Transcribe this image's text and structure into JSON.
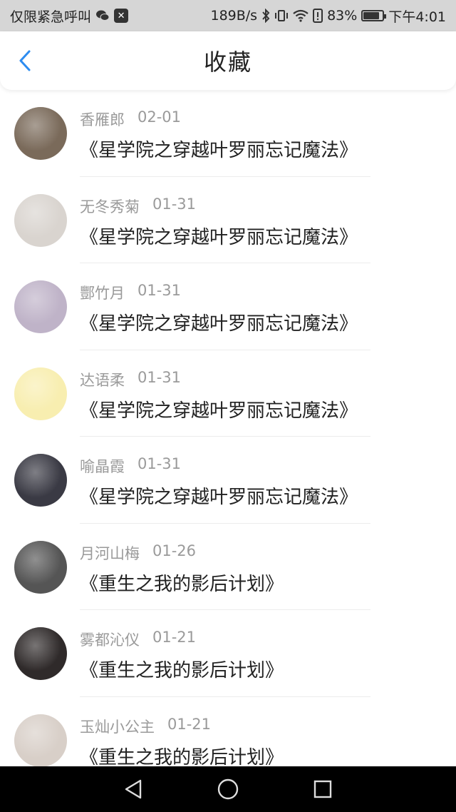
{
  "status_bar": {
    "carrier": "仅限紧急呼叫",
    "speed": "189B/s",
    "battery_pct": "83%",
    "time": "下午4:01",
    "battery_level": 0.83
  },
  "header": {
    "title": "收藏"
  },
  "favorites": [
    {
      "user": "香雁郎",
      "date": "02-01",
      "book": "《星学院之穿越叶罗丽忘记魔法》",
      "avatar_color": "#7a6a5a"
    },
    {
      "user": "无冬秀菊",
      "date": "01-31",
      "book": "《星学院之穿越叶罗丽忘记魔法》",
      "avatar_color": "#d9d4cf"
    },
    {
      "user": "酆竹月",
      "date": "01-31",
      "book": "《星学院之穿越叶罗丽忘记魔法》",
      "avatar_color": "#bfb3c8"
    },
    {
      "user": "达语柔",
      "date": "01-31",
      "book": "《星学院之穿越叶罗丽忘记魔法》",
      "avatar_color": "#f8eeb0"
    },
    {
      "user": "喻晶霞",
      "date": "01-31",
      "book": "《星学院之穿越叶罗丽忘记魔法》",
      "avatar_color": "#3a3a44"
    },
    {
      "user": "月河山梅",
      "date": "01-26",
      "book": "《重生之我的影后计划》",
      "avatar_color": "#555555"
    },
    {
      "user": "雾都沁仪",
      "date": "01-21",
      "book": "《重生之我的影后计划》",
      "avatar_color": "#2f2a2a"
    },
    {
      "user": "玉灿小公主",
      "date": "01-21",
      "book": "《重生之我的影后计划》",
      "avatar_color": "#d8cfc8"
    }
  ],
  "colors": {
    "accent": "#2d8cf0",
    "meta": "#9a9a9a",
    "title": "#222222"
  }
}
